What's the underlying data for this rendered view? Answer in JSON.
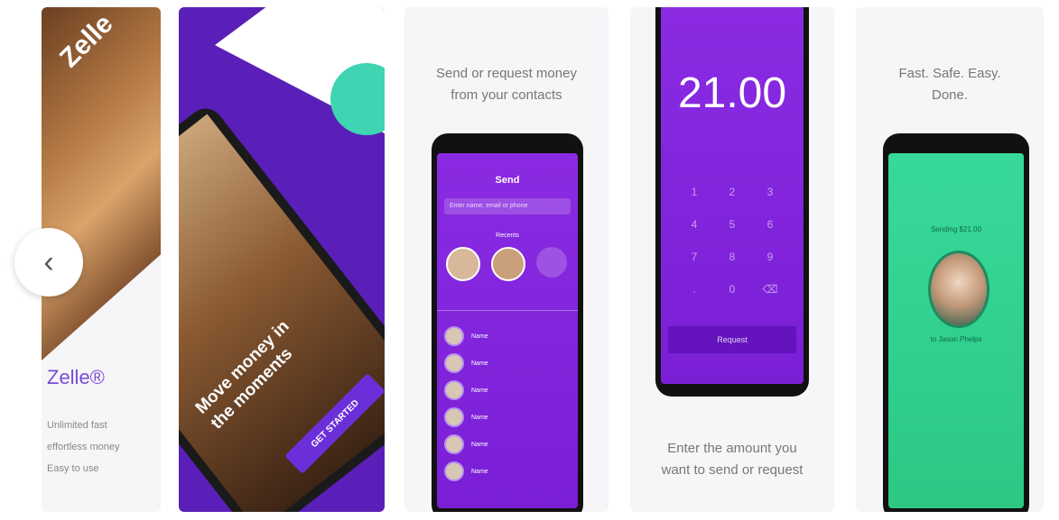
{
  "nav": {
    "prev_arrow": "‹"
  },
  "panel1": {
    "brand_overlay": "Zelle",
    "brand": "Zelle®",
    "tagline": [
      "Unlimited fast",
      "effortless money",
      "Easy to use"
    ]
  },
  "panel2": {
    "headline": "Move money in the moments",
    "button": "GET STARTED"
  },
  "panel3": {
    "caption": [
      "Send or request money",
      "from your contacts"
    ],
    "screen_title": "Send",
    "search_placeholder": "Enter name, email or phone",
    "recents_label": "Recents",
    "contacts": [
      "Name",
      "Name",
      "Name",
      "Name",
      "Name",
      "Name"
    ]
  },
  "panel4": {
    "amount": "21.00",
    "keys": [
      "1",
      "2",
      "3",
      "4",
      "5",
      "6",
      "7",
      "8",
      "9",
      ".",
      "0",
      "⌫"
    ],
    "action_button": "Request",
    "caption": [
      "Enter the amount you",
      "want to send or request"
    ]
  },
  "panel5": {
    "caption": [
      "Fast. Safe. Easy.",
      "Done."
    ],
    "status_top": "Sending $21.00",
    "status_bottom": "to Jason Phelps"
  },
  "colors": {
    "zelle_purple": "#7a1fd6",
    "green": "#2fd08a"
  }
}
